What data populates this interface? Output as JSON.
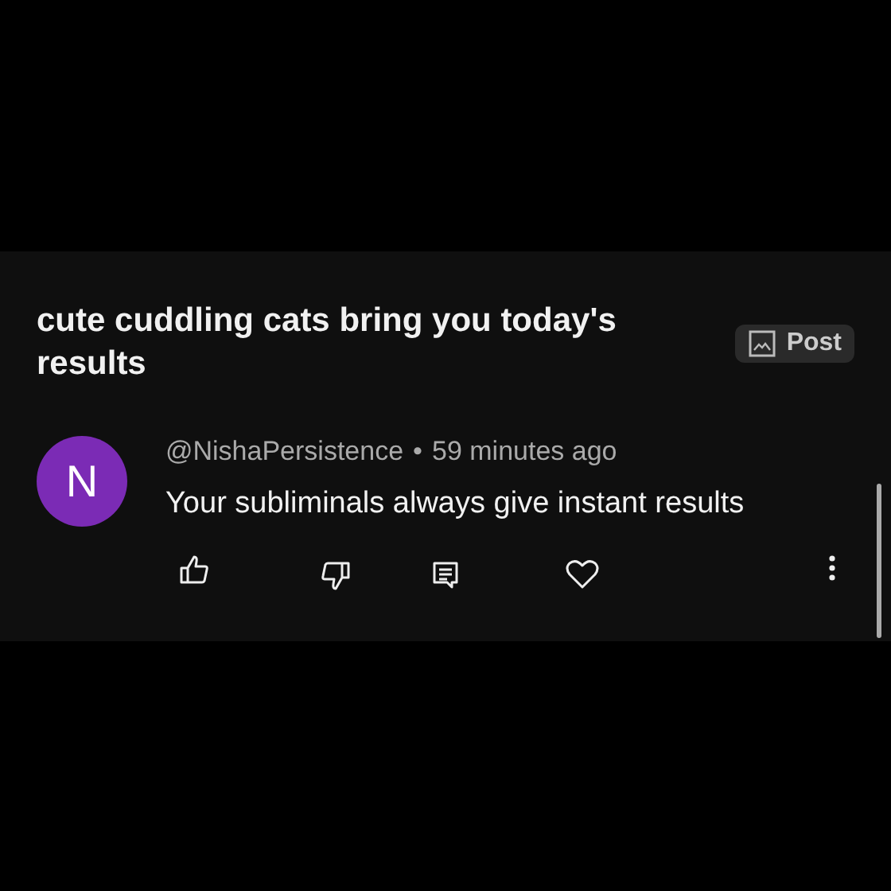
{
  "post_title": "cute cuddling cats bring you today's results",
  "post_badge": {
    "label": "Post"
  },
  "comment": {
    "avatar_letter": "N",
    "author": "@NishaPersistence",
    "separator": "•",
    "time": "59 minutes ago",
    "text": "Your subliminals always give instant results"
  }
}
